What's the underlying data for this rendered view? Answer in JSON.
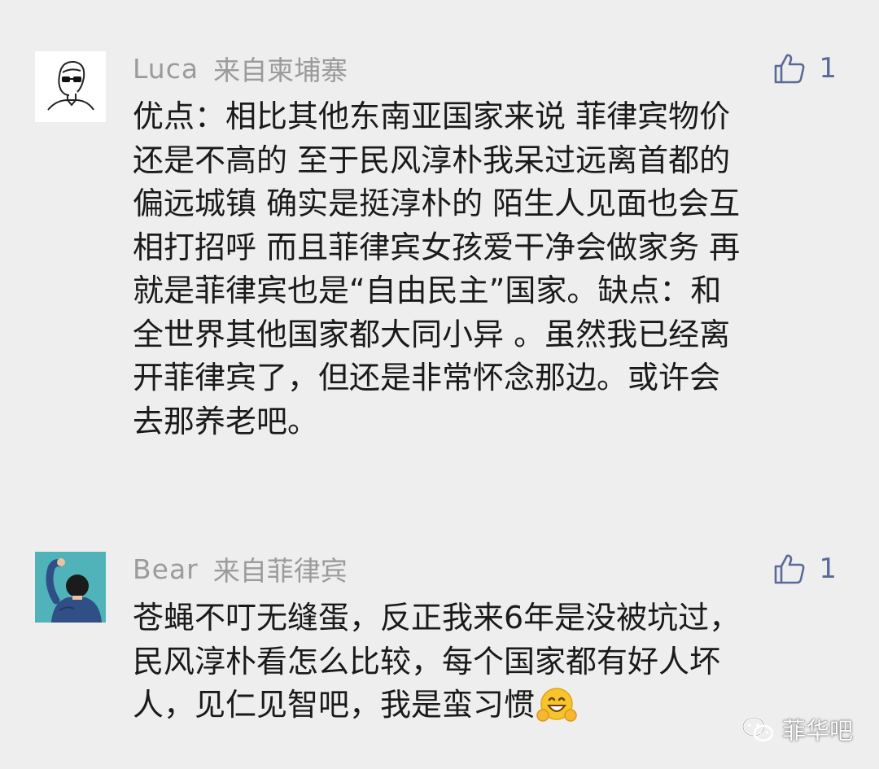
{
  "comments": [
    {
      "username": "Luca",
      "location": "来自柬埔寨",
      "like_count": "1",
      "avatar_icon": "line-drawing-person-with-sunglasses-avatar",
      "lines": [
        "优点：相比其他东南亚国家来说 菲律宾物价",
        "还是不高的 至于民风淳朴我呆过远离首都的",
        "偏远城镇 确实是挺淳朴的 陌生人见面也会互",
        "相打招呼 而且菲律宾女孩爱干净会做家务 再",
        "就是菲律宾也是“自由民主”国家。缺点：和",
        "全世界其他国家都大同小异 。虽然我已经离",
        "开菲律宾了，但还是非常怀念那边。或许会",
        "去那养老吧。"
      ]
    },
    {
      "username": "Bear",
      "location": "来自菲律宾",
      "like_count": "1",
      "avatar_icon": "person-back-view-teal-avatar",
      "lines": [
        "苍蝇不叮无缝蛋，反正我来6年是没被坑过，",
        "民风淳朴看怎么比较，每个国家都有好人坏",
        "人，见仁见智吧，我是蛮习惯"
      ],
      "trailing_emoji": "grinning-emoji-with-hands"
    }
  ],
  "watermark": {
    "icon": "wechat-official-account-icon",
    "text": "菲华吧"
  },
  "colors": {
    "background": "#eeeeee",
    "meta_text": "#9b9b9b",
    "like_accent": "#5a6a96",
    "body_text": "#1a1a1a",
    "bear_avatar_bg": "#4fb3b9"
  }
}
